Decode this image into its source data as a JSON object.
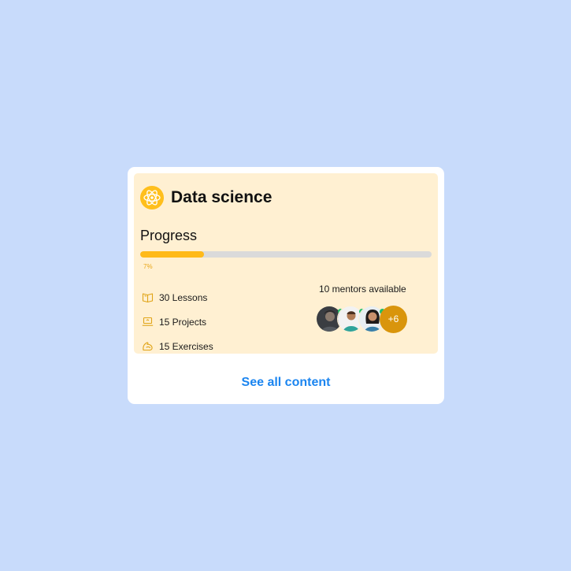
{
  "course": {
    "title": "Data science",
    "icon": "atom-icon",
    "accent_color": "#ffbf1c"
  },
  "progress": {
    "label": "Progress",
    "value_label": "7%",
    "fill_fraction": 0.22,
    "fill_color": "#ffba19",
    "track_color": "#dadada"
  },
  "stats": [
    {
      "icon": "book-icon",
      "label": "30 Lessons"
    },
    {
      "icon": "laptop-icon",
      "label": "15 Projects"
    },
    {
      "icon": "muscle-icon",
      "label": "15 Exercises"
    }
  ],
  "mentors": {
    "label": "10 mentors available",
    "more_label": "+6",
    "online_color": "#21c06a",
    "badge_color": "#d9950c"
  },
  "footer": {
    "see_all_label": "See all content",
    "link_color": "#1b85f0"
  }
}
